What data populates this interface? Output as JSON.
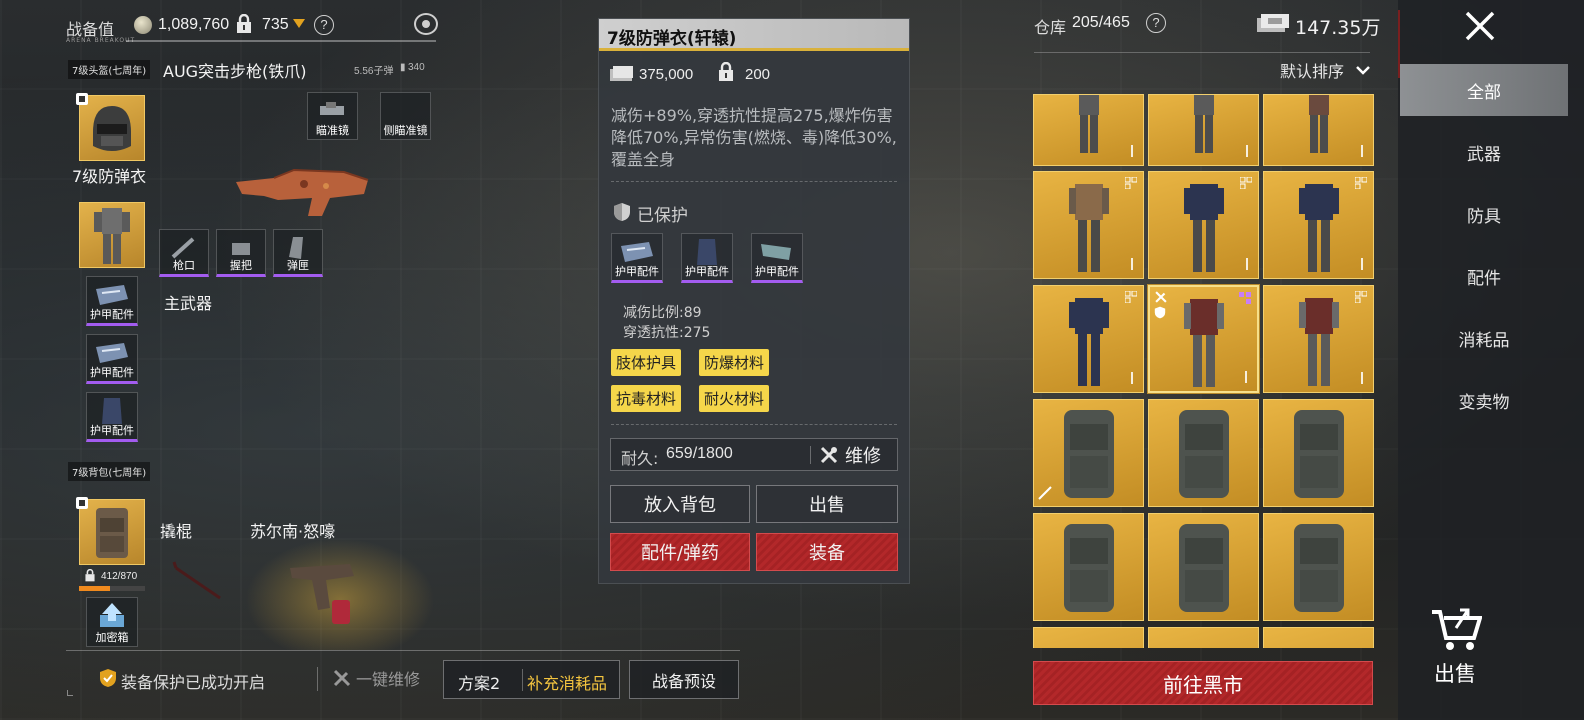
{
  "header": {
    "power_label": "战备值",
    "power_value": "1,089,760",
    "capacity_value": "735",
    "question_mark": "?",
    "brand_small": "ARENA BREAKOUT"
  },
  "loadout": {
    "helmet_label": "7级头盔(七周年)",
    "armor_name": "7级防弹衣",
    "armor_parts": [
      "护甲配件",
      "护甲配件",
      "护甲配件"
    ],
    "backpack_label": "7级背包(七周年)",
    "backpack_capacity": "412/870",
    "encrypted_box_label": "加密箱",
    "primary_weapon": {
      "name": "AUG突击步枪(铁爪)",
      "ammo": "5.56子弹",
      "ammo_count": "340",
      "attach_top": [
        "瞄准镜",
        "侧瞄准镜"
      ],
      "attach_bottom": [
        "枪口",
        "握把",
        "弹匣"
      ],
      "slot_label": "主武器"
    },
    "melee_label": "撬棍",
    "pistol_label": "苏尔南·怒嚎"
  },
  "tooltip": {
    "title": "7级防弹衣(轩辕)",
    "price": "375,000",
    "weight": "200",
    "description": "减伤+89%,穿透抗性提高275,爆炸伤害降低70%,异常伤害(燃烧、毒)降低30%,覆盖全身",
    "protected_label": "已保护",
    "parts": [
      "护甲配件",
      "护甲配件",
      "护甲配件"
    ],
    "stat_damage_label": "减伤比例:",
    "stat_damage_value": "89",
    "stat_pen_label": "穿透抗性:",
    "stat_pen_value": "275",
    "tags": [
      "肢体护具",
      "防爆材料",
      "抗毒材料",
      "耐火材料"
    ],
    "durability_label": "耐久:",
    "durability_value": "659/1800",
    "repair_label": "维修",
    "btn_backpack": "放入背包",
    "btn_sell": "出售",
    "btn_attach": "配件/弹药",
    "btn_equip": "装备"
  },
  "inventory": {
    "warehouse_label": "仓库",
    "warehouse_value": "205/465",
    "money": "147.35万",
    "sort_label": "默认排序",
    "market_button": "前往黑市"
  },
  "categories": {
    "items": [
      "全部",
      "武器",
      "防具",
      "配件",
      "消耗品",
      "变卖物"
    ],
    "active": "全部",
    "sell_label": "出售"
  },
  "bottom": {
    "protect_status": "装备保护已成功开启",
    "repair_all": "一键维修",
    "plan_label": "方案2",
    "refill_label": "补充消耗品",
    "preset_label": "战备预设"
  },
  "colors": {
    "gold": "#e3b24b",
    "red": "#b3282a",
    "purple": "#a35cf0",
    "tag_yellow": "#f5d64a"
  }
}
